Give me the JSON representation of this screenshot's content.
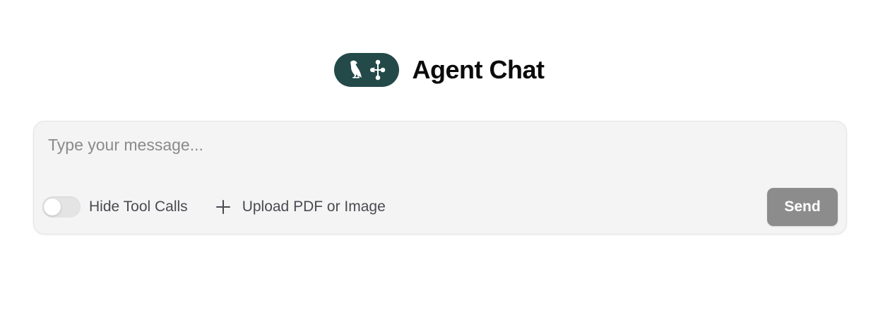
{
  "header": {
    "title": "Agent Chat",
    "logo_icons": [
      "parrot-icon",
      "network-icon"
    ],
    "logo_color": "#234949"
  },
  "composer": {
    "message_placeholder": "Type your message...",
    "message_value": "",
    "hide_tool_calls": {
      "label": "Hide Tool Calls",
      "checked": false
    },
    "upload": {
      "label": "Upload PDF or Image",
      "icon": "plus-icon"
    },
    "send_label": "Send",
    "send_color": "#8c8c8c"
  }
}
